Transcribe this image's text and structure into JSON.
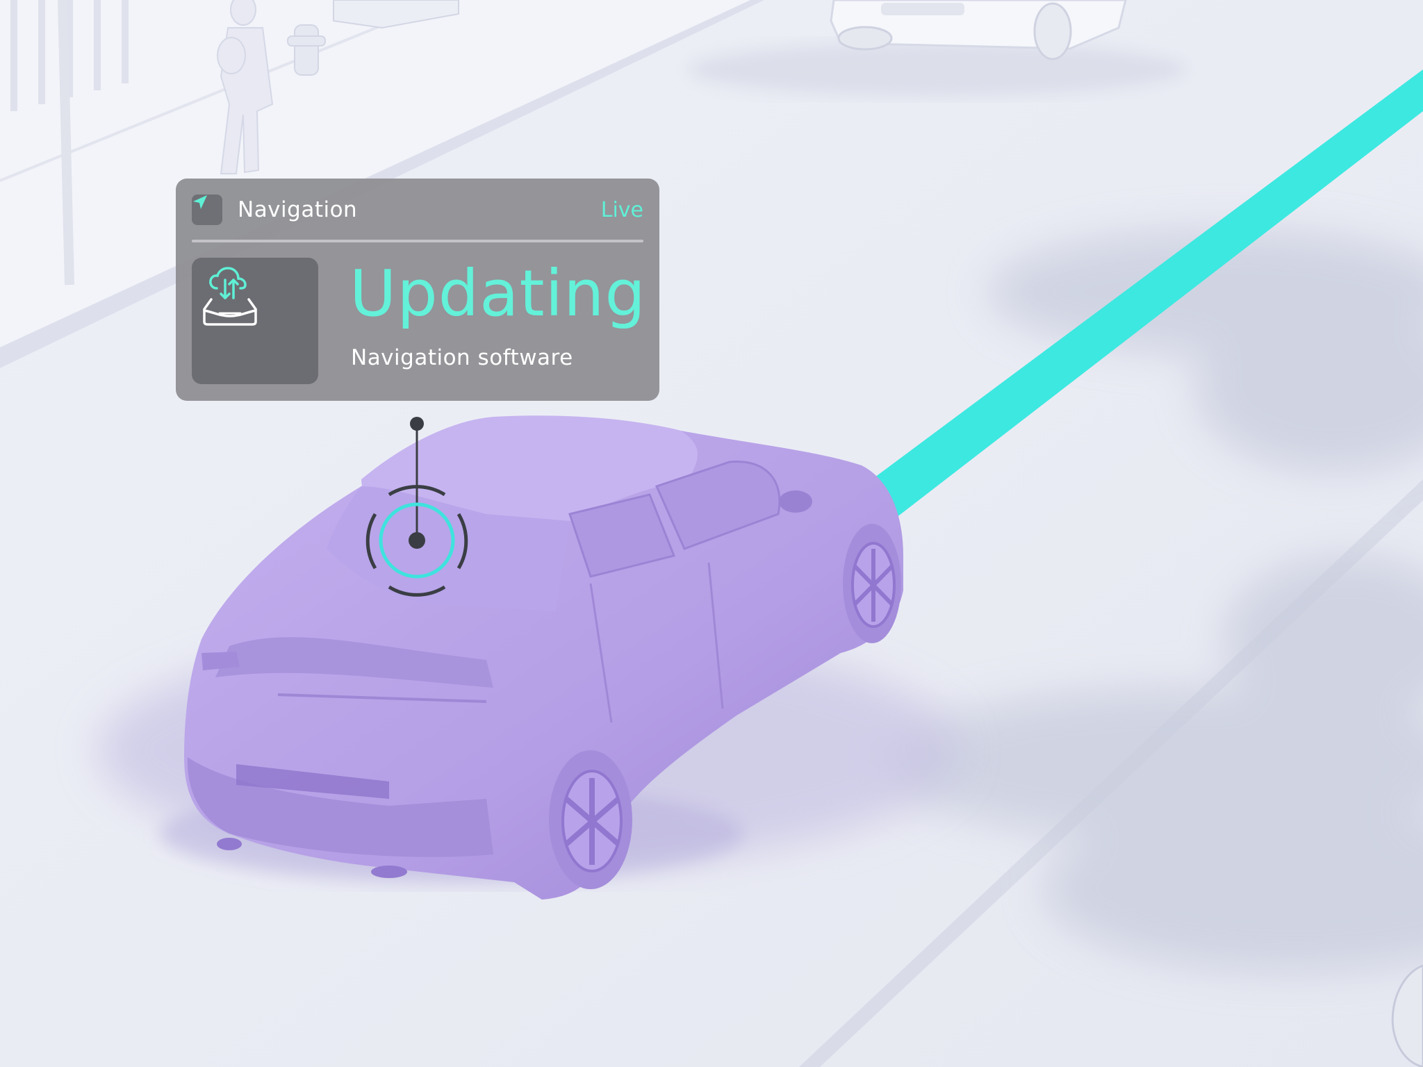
{
  "navigation_card": {
    "title": "Navigation",
    "status_tag": "Live",
    "status": "Updating",
    "subtitle": "Navigation software",
    "header_icon": "navigation-arrow-icon",
    "tile_icon": "cloud-sync-car-icon"
  },
  "colors": {
    "accent": "#3de8e0",
    "status_text": "#63f1d9",
    "car": "#b7a0e6",
    "card": "#8c8c90",
    "marker": "#3a3e44"
  }
}
